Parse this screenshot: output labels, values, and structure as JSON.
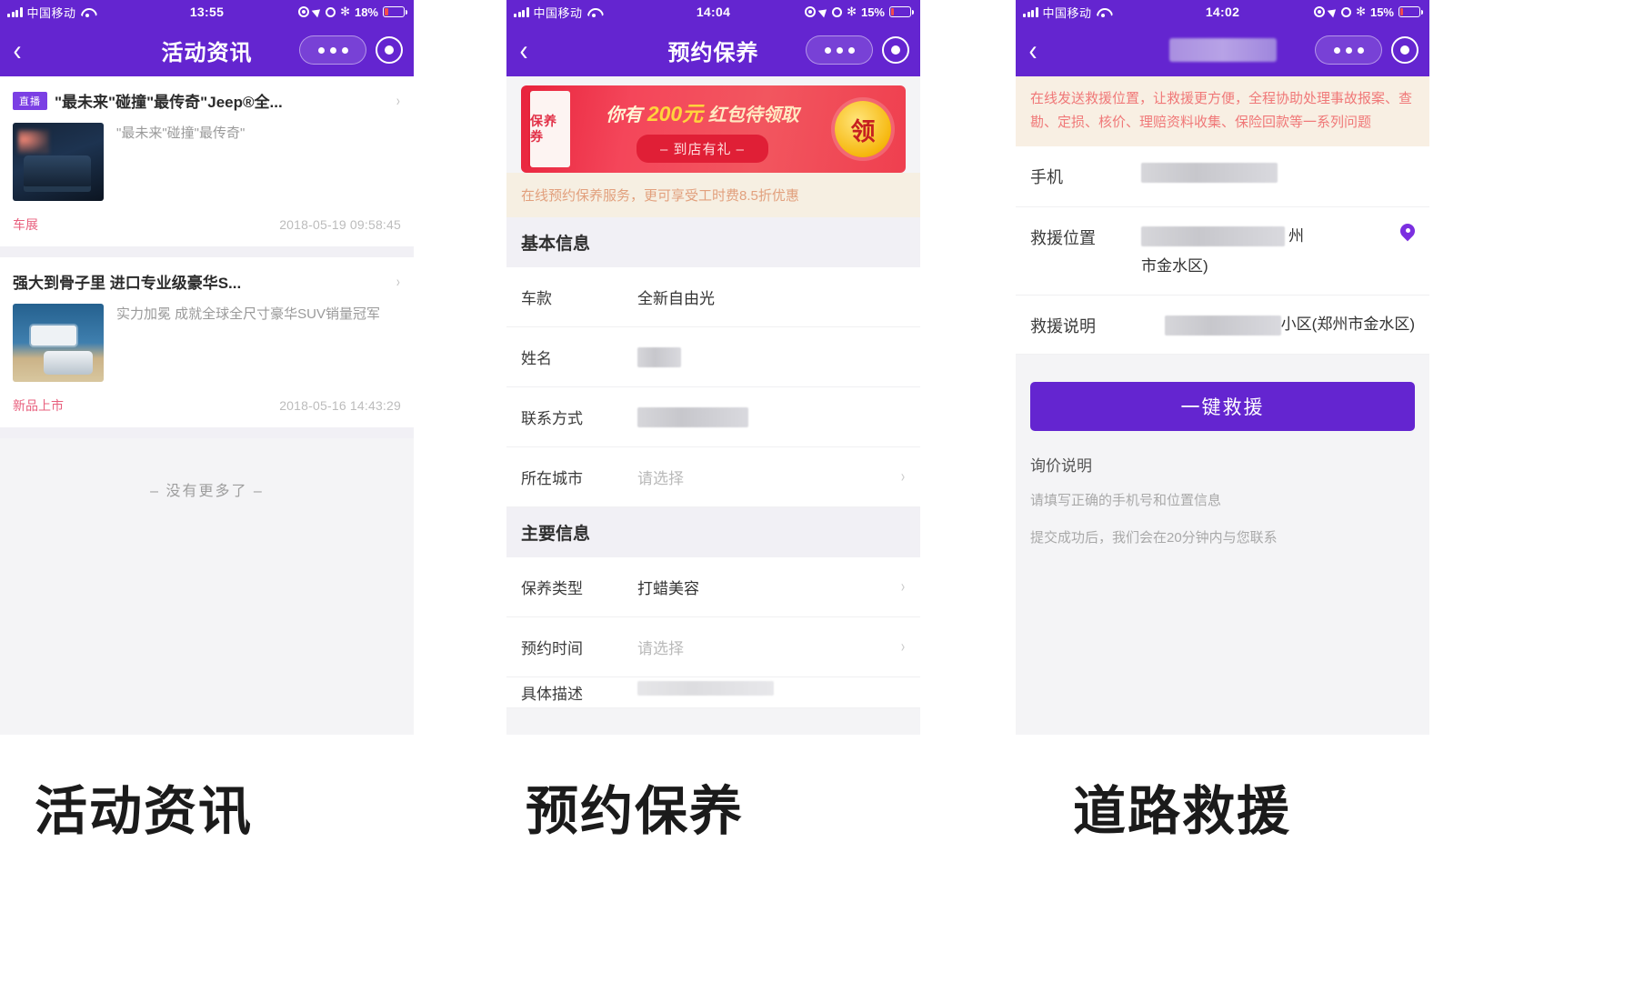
{
  "panels": [
    {
      "id": "news",
      "status": {
        "carrier": "中国移动",
        "time": "13:55",
        "battery": "18%",
        "battery_pct": 18
      },
      "nav": {
        "title": "活动资讯"
      },
      "articles": [
        {
          "tag": "直播",
          "title": "\"最未来\"碰撞\"最传奇\"Jeep®全...",
          "desc": "\"最未来\"碰撞\"最传奇\"",
          "category": "车展",
          "timestamp": "2018-05-19 09:58:45"
        },
        {
          "tag": "",
          "title": "强大到骨子里 进口专业级豪华S...",
          "desc": "实力加冕 成就全球全尺寸豪华SUV销量冠军",
          "category": "新品上市",
          "timestamp": "2018-05-16 14:43:29"
        }
      ],
      "footer_text": "– 没有更多了 –",
      "caption": "活动资讯"
    },
    {
      "id": "maintenance",
      "status": {
        "carrier": "中国移动",
        "time": "14:04",
        "battery": "15%",
        "battery_pct": 15
      },
      "nav": {
        "title": "预约保养"
      },
      "banner": {
        "coupon_label": "保养券",
        "headline_prefix": "你有",
        "headline_amount": "200元",
        "headline_suffix": "红包待领取",
        "button": "– 到店有礼 –",
        "badge": "领"
      },
      "promo": "在线预约保养服务，更可享受工时费8.5折优惠",
      "sections": [
        {
          "title": "基本信息",
          "rows": [
            {
              "label": "车款",
              "value": "全新自由光",
              "type": "text",
              "chevron": false
            },
            {
              "label": "姓名",
              "value": "",
              "type": "mask",
              "mask_width": 48,
              "chevron": false
            },
            {
              "label": "联系方式",
              "value": "",
              "type": "mask",
              "mask_width": 120,
              "chevron": false
            },
            {
              "label": "所在城市",
              "value": "请选择",
              "type": "placeholder",
              "chevron": true
            }
          ]
        },
        {
          "title": "主要信息",
          "rows": [
            {
              "label": "保养类型",
              "value": "打蜡美容",
              "type": "text",
              "chevron": true
            },
            {
              "label": "预约时间",
              "value": "请选择",
              "type": "placeholder",
              "chevron": true
            },
            {
              "label": "具体描述",
              "value": "",
              "type": "cut",
              "chevron": false
            }
          ]
        }
      ],
      "caption": "预约保养"
    },
    {
      "id": "rescue",
      "status": {
        "carrier": "中国移动",
        "time": "14:02",
        "battery": "15%",
        "battery_pct": 15
      },
      "nav": {
        "title": "",
        "title_masked": true
      },
      "warning": "在线发送救援位置，让救援更方便，全程协助处理事故报案、查勘、定损、核价、理赔资料收集、保险回款等一系列问题",
      "rows": [
        {
          "label": "手机",
          "value": "",
          "type": "mask",
          "mask_width": 150,
          "pin": false
        },
        {
          "label": "救援位置",
          "value": "州\n市金水区)",
          "type": "mask_text",
          "mask_width": 160,
          "suffix": "州",
          "line2": "市金水区)",
          "pin": true
        },
        {
          "label": "救援说明",
          "value": "小区(郑州市金水区)",
          "type": "mask_text2",
          "mask_width": 130,
          "pin": false
        }
      ],
      "button": "一键救援",
      "notes": {
        "title": "询价说明",
        "lines": [
          "请填写正确的手机号和位置信息",
          "提交成功后，我们会在20分钟内与您联系"
        ]
      },
      "caption": "道路救援"
    }
  ]
}
